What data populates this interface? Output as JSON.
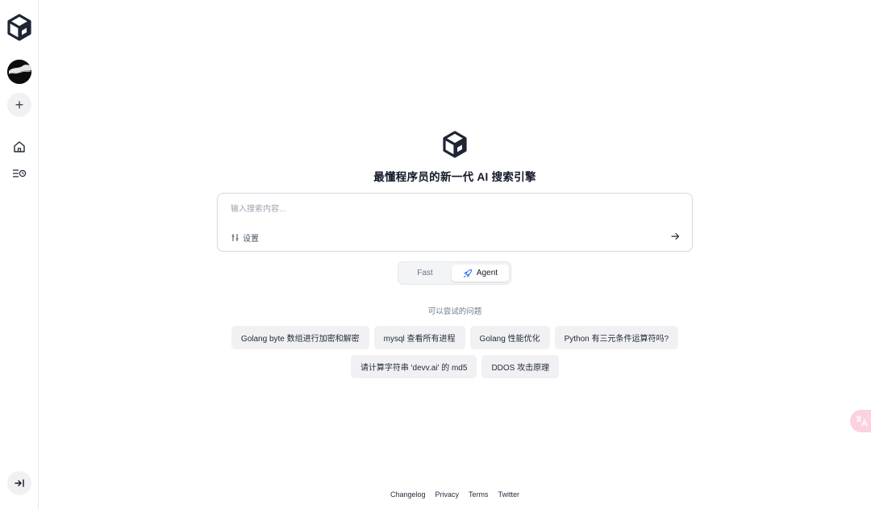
{
  "sidebar": {
    "logo_icon": "cube-logo-icon",
    "avatar_icon": "user-avatar",
    "new_icon": "plus-icon",
    "new_label": "+",
    "home_icon": "home-icon",
    "history_icon": "history-list-icon",
    "collapse_icon": "expand-sidebar-icon"
  },
  "hero": {
    "logo_icon": "cube-logo-icon",
    "title": "最懂程序员的新一代 AI 搜索引擎"
  },
  "search": {
    "placeholder": "输入搜索内容...",
    "value": "",
    "settings_label": "设置",
    "settings_icon": "sliders-icon",
    "send_icon": "arrow-right-icon"
  },
  "modes": {
    "fast_label": "Fast",
    "agent_label": "Agent",
    "agent_icon": "rocket-icon",
    "selected": "Agent"
  },
  "suggestions": {
    "label": "可以尝试的问题",
    "row1": [
      "Golang byte 数组进行加密和解密",
      "mysql 查看所有进程",
      "Golang 性能优化",
      "Python 有三元条件运算符吗?"
    ],
    "row2": [
      "请计算字符串 'devv.ai' 的 md5",
      "DDOS 攻击原理"
    ]
  },
  "translate_icon": "translate-icon",
  "colors": {
    "accent_dark": "#111827",
    "chip_bg": "#f1f1f3",
    "translate_bg": "#fbd3df"
  },
  "footer": {
    "links": [
      "Changelog",
      "Privacy",
      "Terms",
      "Twitter"
    ]
  }
}
